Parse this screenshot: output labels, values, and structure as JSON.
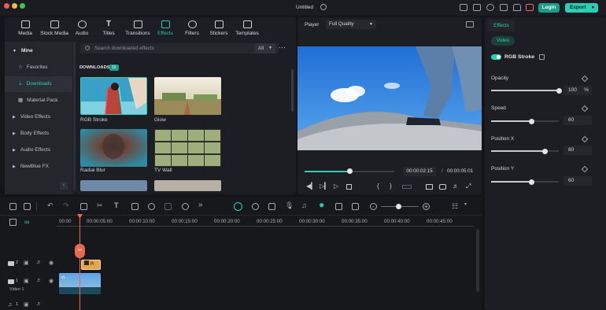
{
  "window": {
    "title": "Untitled"
  },
  "header": {
    "login_label": "Login",
    "export_label": "Export"
  },
  "media_tabs": [
    {
      "label": "Media",
      "icon": "media-icon"
    },
    {
      "label": "Stock Media",
      "icon": "stock-media-icon"
    },
    {
      "label": "Audio",
      "icon": "music-note-icon"
    },
    {
      "label": "Titles",
      "icon": "title-t-icon"
    },
    {
      "label": "Transitions",
      "icon": "transitions-icon"
    },
    {
      "label": "Effects",
      "icon": "effects-sparkle-icon",
      "active": true
    },
    {
      "label": "Filters",
      "icon": "filters-icon"
    },
    {
      "label": "Stickers",
      "icon": "stickers-icon"
    },
    {
      "label": "Templates",
      "icon": "templates-icon"
    }
  ],
  "sidebar": {
    "items": [
      {
        "label": "Mine"
      },
      {
        "label": "Favorites"
      },
      {
        "label": "Downloads",
        "active": true
      },
      {
        "label": "Material Pack"
      },
      {
        "label": "Video Effects"
      },
      {
        "label": "Body Effects"
      },
      {
        "label": "Audio Effects"
      },
      {
        "label": "NewBlue FX"
      }
    ]
  },
  "search": {
    "placeholder": "Search downloaded effects",
    "filter_value": "All"
  },
  "downloads": {
    "heading": "DOWNLOADS",
    "count": "15"
  },
  "effects_grid": [
    {
      "label": "RGB Stroke",
      "selected": true
    },
    {
      "label": "Glow"
    },
    {
      "label": "Radial Blur"
    },
    {
      "label": "TV Wall"
    }
  ],
  "player": {
    "label": "Player",
    "quality": "Full Quality",
    "current_time": "00:00:02:15",
    "separator": "/",
    "total_time": "00:00:05:01",
    "progress": 0.5
  },
  "properties": {
    "tab": "Effects",
    "subtab": "Video",
    "effect_name": "RGB Stroke",
    "params": [
      {
        "label": "Opacity",
        "value": "100",
        "unit": "%",
        "fraction": 1.0
      },
      {
        "label": "Speed",
        "value": "60",
        "unit": "",
        "fraction": 0.6
      },
      {
        "label": "Position X",
        "value": "80",
        "unit": "",
        "fraction": 0.8
      },
      {
        "label": "Position Y",
        "value": "60",
        "unit": "",
        "fraction": 0.6
      }
    ]
  },
  "timeline": {
    "ruler": [
      "00:00",
      "00:00:05:00",
      "00:00:10:00",
      "00:00:15:00",
      "00:00:20:00",
      "00:00:25:00",
      "00:00:30:00",
      "00:00:35:00",
      "00:00:40:00",
      "00:00:45:00"
    ],
    "tracks": [
      {
        "number": "2",
        "type": "effect"
      },
      {
        "number": "1",
        "type": "video",
        "name": "Video 1"
      },
      {
        "number": "1",
        "type": "audio"
      }
    ],
    "clip_label": "vi..."
  },
  "colors": {
    "accent": "#2bd0b4",
    "playhead": "#e8694e",
    "effect_clip": "#e3a64a",
    "video_clip": "#3c7fb8"
  }
}
